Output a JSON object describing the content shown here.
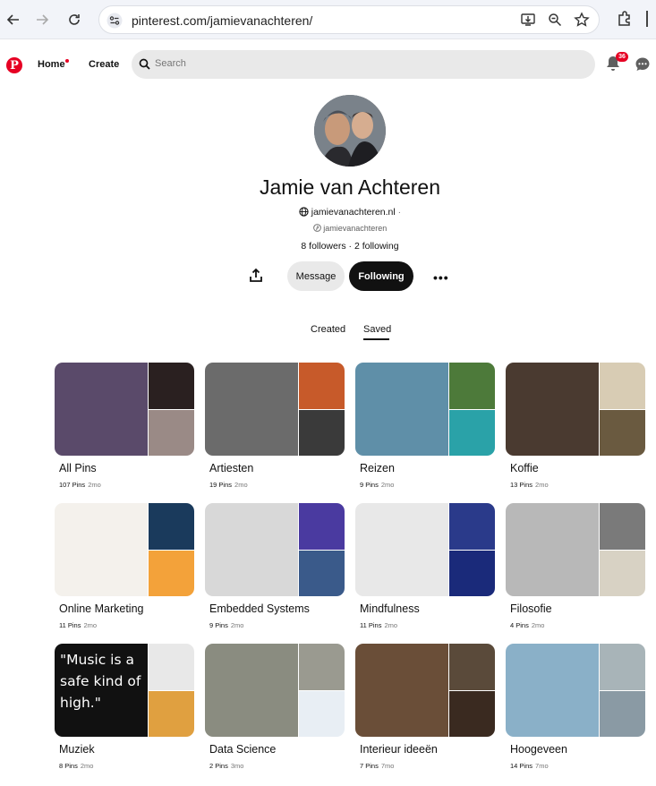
{
  "browser": {
    "url": "pinterest.com/jamievanachteren/"
  },
  "header": {
    "logo": "P",
    "home_label": "Home",
    "create_label": "Create",
    "search_placeholder": "Search",
    "notification_count": "36"
  },
  "profile": {
    "name": "Jamie van Achteren",
    "website": "jamievanachteren.nl",
    "website_suffix": " ·",
    "username": "jamievanachteren",
    "followers": "8 followers",
    "following_count": "2 following",
    "message_label": "Message",
    "following_label": "Following",
    "more_label": "•••"
  },
  "tabs": {
    "created": "Created",
    "saved": "Saved",
    "active": "saved"
  },
  "boards": [
    {
      "title": "All Pins",
      "pins": "107 Pins",
      "age": "2mo",
      "colors": [
        "#5a4a6a",
        "#2a2020",
        "#9a8a86"
      ]
    },
    {
      "title": "Artiesten",
      "pins": "19 Pins",
      "age": "2mo",
      "colors": [
        "#6b6b6b",
        "#c75a2a",
        "#3a3a3a"
      ]
    },
    {
      "title": "Reizen",
      "pins": "9 Pins",
      "age": "2mo",
      "colors": [
        "#5f8fa8",
        "#4d7a3a",
        "#2aa2a8"
      ]
    },
    {
      "title": "Koffie",
      "pins": "13 Pins",
      "age": "2mo",
      "colors": [
        "#4a3a30",
        "#d8ccb4",
        "#6a5a40"
      ]
    },
    {
      "title": "Online Marketing",
      "pins": "11 Pins",
      "age": "2mo",
      "colors": [
        "#f4f1ec",
        "#1a3a5c",
        "#f3a23a"
      ]
    },
    {
      "title": "Embedded Systems",
      "pins": "9 Pins",
      "age": "2mo",
      "colors": [
        "#d8d8d8",
        "#4a3aa0",
        "#3a5a8a"
      ]
    },
    {
      "title": "Mindfulness",
      "pins": "11 Pins",
      "age": "2mo",
      "colors": [
        "#e8e8e8",
        "#2a3a8a",
        "#1a2a7a"
      ]
    },
    {
      "title": "Filosofie",
      "pins": "4 Pins",
      "age": "2mo",
      "colors": [
        "#b8b8b8",
        "#7a7a7a",
        "#d8d2c4"
      ]
    },
    {
      "title": "Muziek",
      "pins": "8 Pins",
      "age": "2mo",
      "colors": [
        "#111111",
        "#e8e8e8",
        "#e0a040"
      ],
      "quote": "\"Music is a safe kind of high.\""
    },
    {
      "title": "Data Science",
      "pins": "2 Pins",
      "age": "3mo",
      "colors": [
        "#8a8c80",
        "#9a9a90",
        "#e8eef4"
      ]
    },
    {
      "title": "Interieur ideeën",
      "pins": "7 Pins",
      "age": "7mo",
      "colors": [
        "#6a4e38",
        "#5a4a3a",
        "#3a2a20"
      ]
    },
    {
      "title": "Hoogeveen",
      "pins": "14 Pins",
      "age": "7mo",
      "colors": [
        "#8ab0c8",
        "#a8b4b8",
        "#8a9aa4"
      ]
    }
  ]
}
